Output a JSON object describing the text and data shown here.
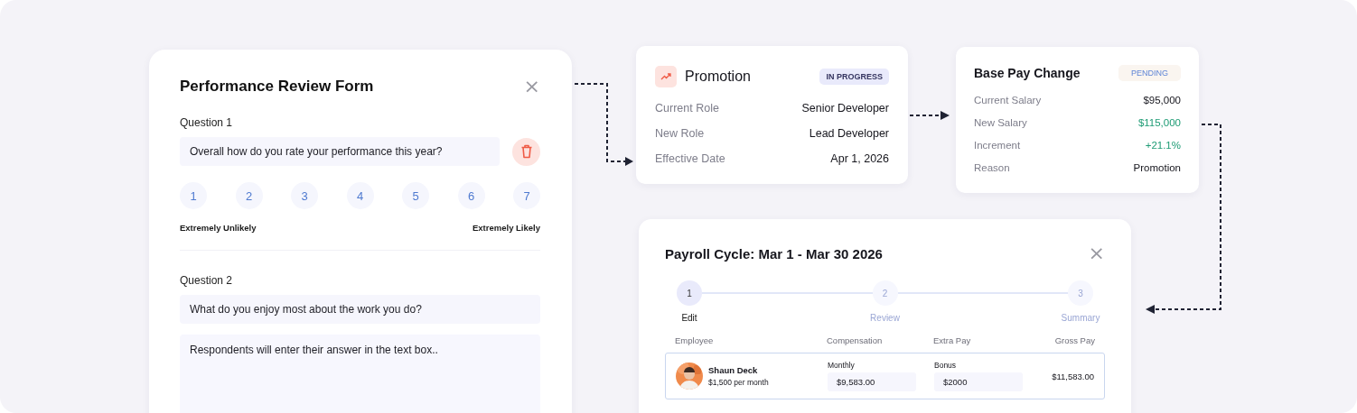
{
  "review_form": {
    "title": "Performance Review Form",
    "close": "×",
    "questions": [
      {
        "label": "Question 1",
        "kind": "scale",
        "text": "Overall how do you rate your performance this year?",
        "scale": [
          "1",
          "2",
          "3",
          "4",
          "5",
          "6",
          "7"
        ],
        "low_label": "Extremely Unlikely",
        "high_label": "Extremely Likely"
      },
      {
        "label": "Question 2",
        "kind": "open",
        "text": "What do you enjoy most about the work you do?",
        "placeholder": "Respondents will enter their answer in the text box.."
      }
    ]
  },
  "promotion": {
    "title": "Promotion",
    "status": {
      "label": "IN PROGRESS",
      "kind": "in_progress"
    },
    "rows": [
      {
        "label": "Current Role",
        "value": "Senior Developer"
      },
      {
        "label": "New Role",
        "value": "Lead Developer"
      },
      {
        "label": "Effective Date",
        "value": "Apr 1, 2026"
      }
    ]
  },
  "base_pay_change": {
    "title": "Base Pay Change",
    "status": {
      "label": "PENDING",
      "kind": "pending"
    },
    "rows": [
      {
        "label": "Current Salary",
        "value": "$95,000",
        "kind": "plain"
      },
      {
        "label": "New Salary",
        "value": "$115,000",
        "kind": "positive"
      },
      {
        "label": "Increment",
        "value": "+21.1%",
        "kind": "positive"
      },
      {
        "label": "Reason",
        "value": "Promotion",
        "kind": "plain"
      }
    ]
  },
  "payroll": {
    "title": "Payroll Cycle: Mar 1 - Mar 30 2026",
    "close": "×",
    "steps": [
      {
        "number": "1",
        "label": "Edit",
        "selected": true
      },
      {
        "number": "2",
        "label": "Review",
        "selected": false
      },
      {
        "number": "3",
        "label": "Summary",
        "selected": false
      }
    ],
    "columns": [
      "Employee",
      "Compensation",
      "Extra Pay",
      "Gross Pay"
    ],
    "rows": [
      {
        "name": "Shaun Deck",
        "rate": "$1,500 per month",
        "compensation_label": "Monthly",
        "compensation": "$9,583.00",
        "extra_label": "Bonus",
        "extra": "$2000",
        "gross": "$11,583.00"
      }
    ]
  }
}
